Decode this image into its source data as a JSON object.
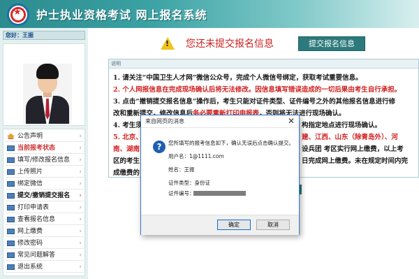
{
  "header": {
    "title": "护士执业资格考试  网上报名系统",
    "logo_icon": "star-emblem-icon"
  },
  "sidebar": {
    "greeting": "您好：王振",
    "menu": [
      {
        "label": "公告声明",
        "icon": "home-icon"
      },
      {
        "label": "当前报考状态",
        "icon": "list-icon",
        "state": "highlight"
      },
      {
        "label": "填写/修改报名信息",
        "icon": "list-icon"
      },
      {
        "label": "上传照片",
        "icon": "list-icon"
      },
      {
        "label": "绑定微信",
        "icon": "list-icon"
      },
      {
        "label": "提交/撤销提交报名",
        "icon": "doc-icon",
        "state": "active"
      },
      {
        "label": "打印申请表",
        "icon": "list-icon"
      },
      {
        "label": "查看报名信息",
        "icon": "list-icon"
      },
      {
        "label": "网上缴费",
        "icon": "list-icon"
      },
      {
        "label": "修改密码",
        "icon": "list-icon"
      },
      {
        "label": "常见问题解答",
        "icon": "list-icon"
      },
      {
        "label": "退出系统",
        "icon": "list-icon"
      }
    ],
    "arrow_glyph": "›"
  },
  "main": {
    "status_text": "您还未提交报名信息",
    "submit_button": "提交报名信息",
    "notice": {
      "header": "说明",
      "line1": "1. 请关注“中国卫生人才网”微信公众号，完成个人微信号绑定，获取考试重要信息。",
      "line2": "2. 个人网报信息在完成现场确认后将无法修改。因信息填写错误造成的一切后果由考生自行承担。",
      "line3": "3. 点击“撤销提交报名信息”操作后，考生只能对证件类型、证件编号之外的其他报名信息进行修",
      "line4a": "改和重新提交，修改信息后",
      "line4b": "务必要重新打印申报表",
      "line4c": "，否则将无法进行现场确认。",
      "line5a": "4. 考生须",
      "line5b": "构指定地点进行现场确认。",
      "line6a": "5. 北京、",
      "line6b": "建、江西、山东（除青岛外）、河",
      "line7a": "南、湖南",
      "line7b": "设兵团 考区实行网上缴费，以上考",
      "line8a": "区的考生",
      "line8b": "日完成网上缴费。未在规定时间内完",
      "line9a": "成缴费的"
    }
  },
  "dialog": {
    "title": "来自网页的消息",
    "close_glyph": "✕",
    "message": "您所填写的报考信息如下，确认无误后点击确认提交。",
    "username": "用户名：1@1111.com",
    "name": "姓名：王振",
    "id_type": "证件类型：身份证",
    "id_number_label": "证件编号：",
    "ok": "确定",
    "cancel": "取消"
  },
  "colors": {
    "accent": "#2c7a7b",
    "warning_red": "#d22222",
    "header_teal": "#3aa1a3"
  }
}
